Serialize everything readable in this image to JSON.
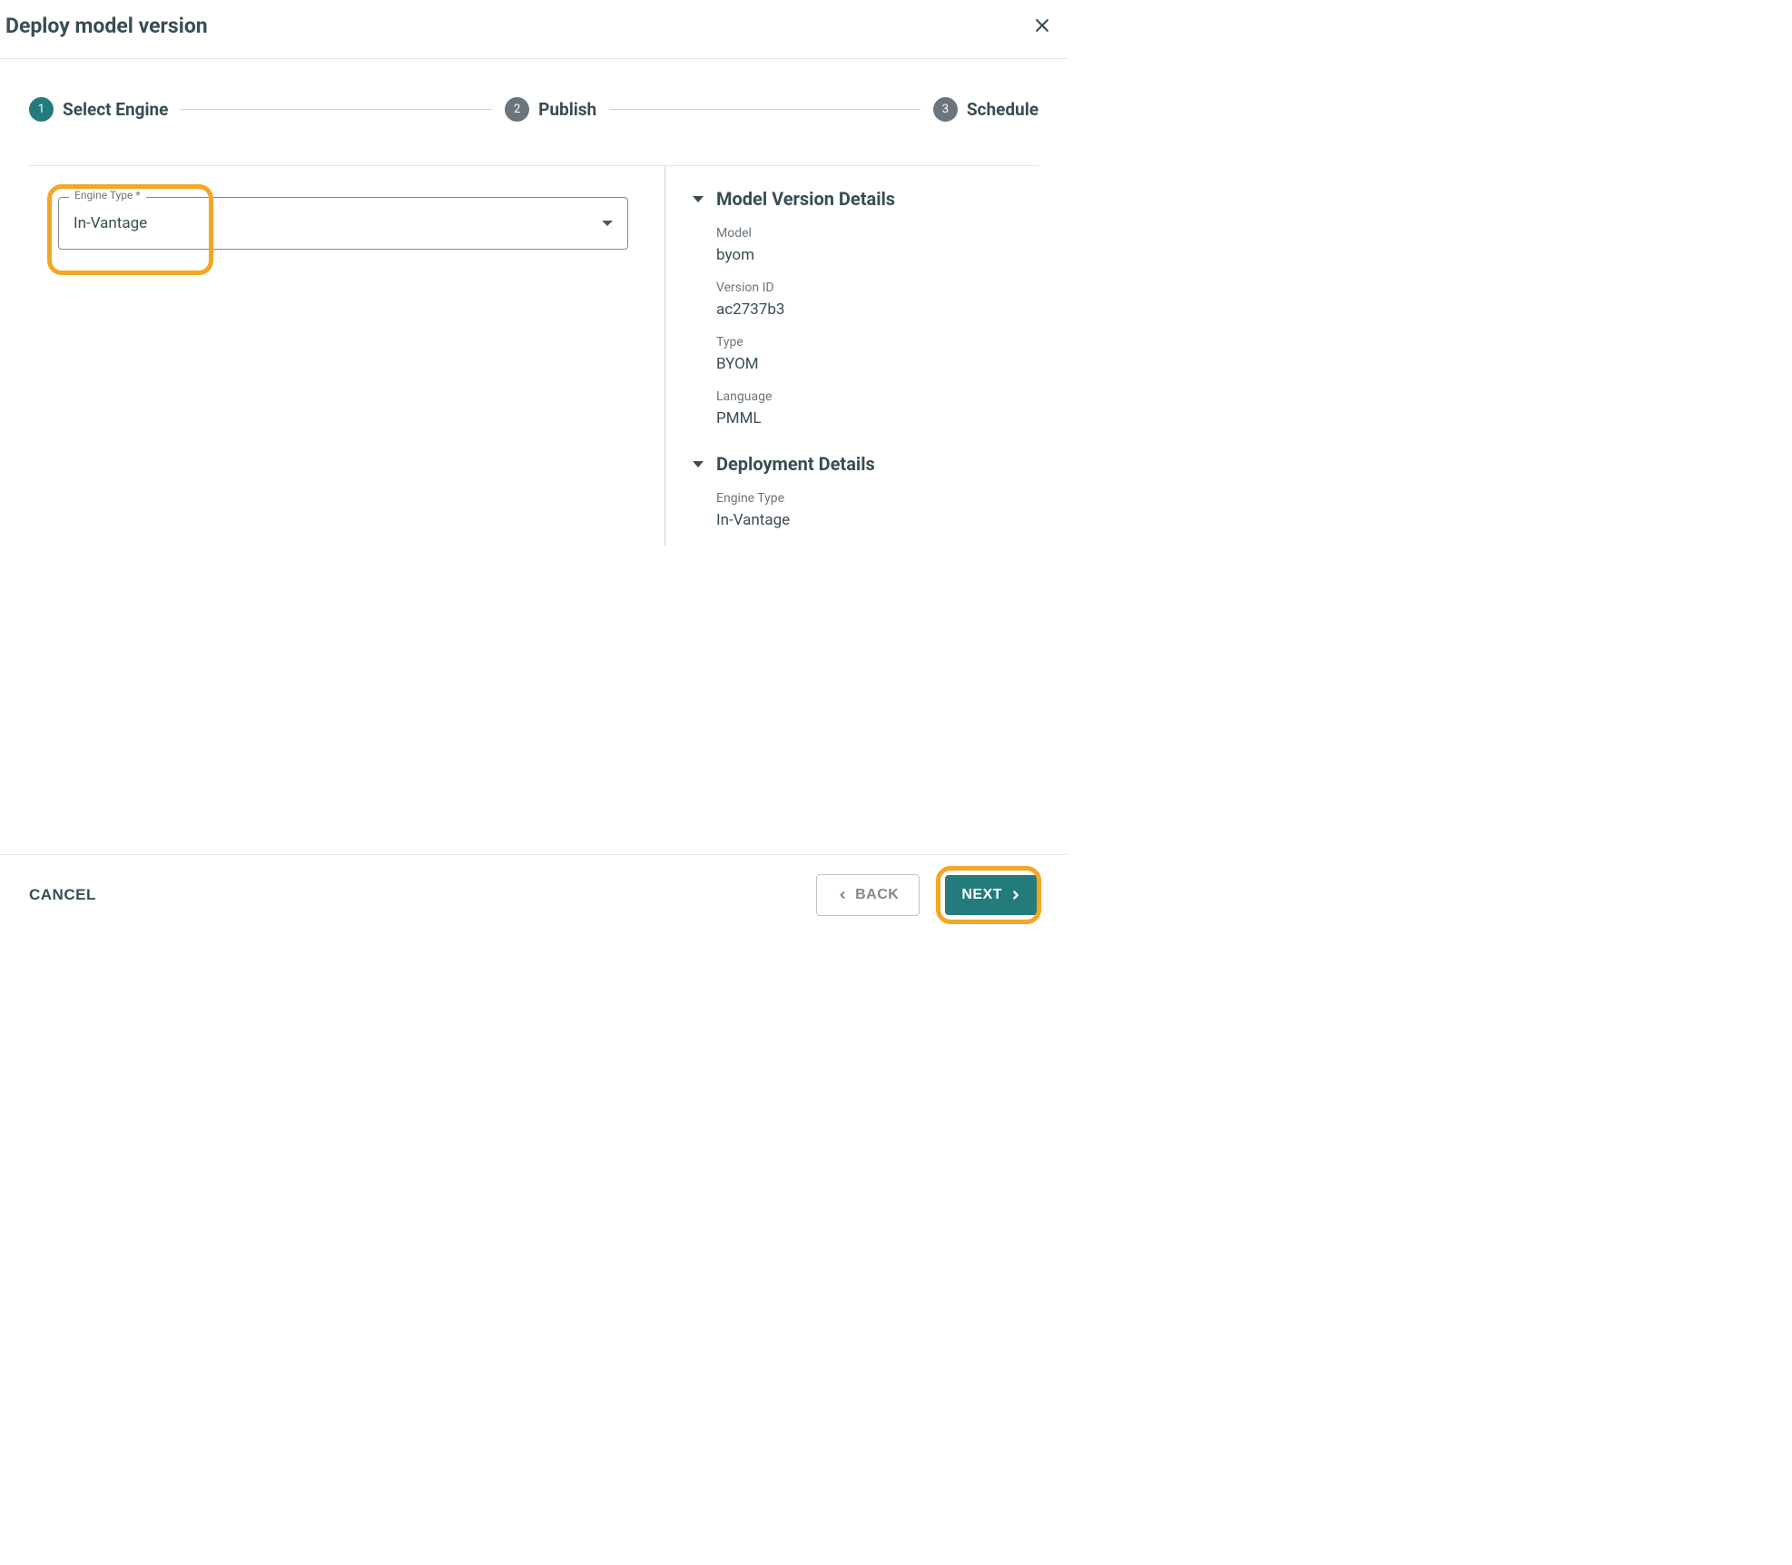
{
  "header": {
    "title": "Deploy model version"
  },
  "stepper": {
    "steps": [
      {
        "num": "1",
        "label": "Select Engine",
        "active": true
      },
      {
        "num": "2",
        "label": "Publish",
        "active": false
      },
      {
        "num": "3",
        "label": "Schedule",
        "active": false
      }
    ]
  },
  "engineSelect": {
    "label": "Engine Type *",
    "value": "In-Vantage"
  },
  "modelDetails": {
    "title": "Model Version Details",
    "rows": [
      {
        "label": "Model",
        "value": "byom"
      },
      {
        "label": "Version ID",
        "value": "ac2737b3"
      },
      {
        "label": "Type",
        "value": "BYOM"
      },
      {
        "label": "Language",
        "value": "PMML"
      }
    ]
  },
  "deploymentDetails": {
    "title": "Deployment Details",
    "rows": [
      {
        "label": "Engine Type",
        "value": "In-Vantage"
      }
    ]
  },
  "footer": {
    "cancel": "CANCEL",
    "back": "BACK",
    "next": "NEXT"
  }
}
